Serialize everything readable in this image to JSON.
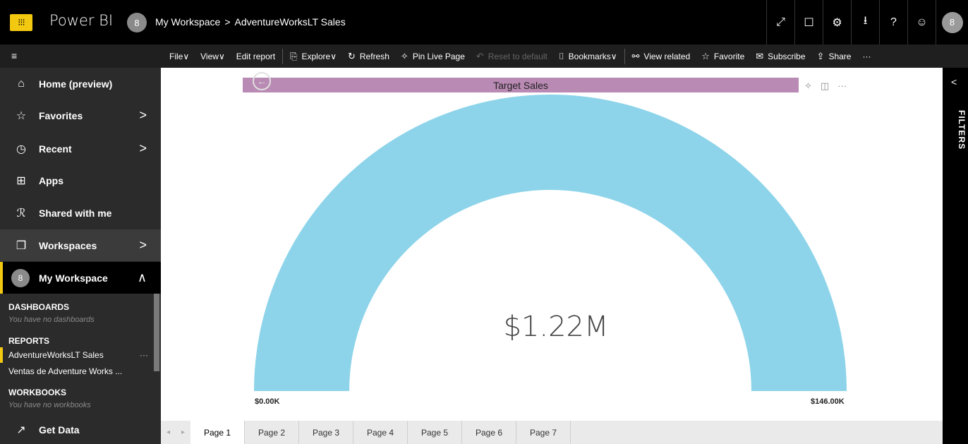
{
  "topbar": {
    "app_name": "Power BI",
    "workspace_initial": "8",
    "breadcrumb": [
      "My Workspace",
      "AdventureWorksLT Sales"
    ],
    "breadcrumb_separator": ">",
    "icons": [
      "expand-icon",
      "comment-icon",
      "settings-icon",
      "download-icon",
      "help-icon",
      "feedback-icon"
    ],
    "icon_glyphs": [
      "⤢",
      "☐",
      "⚙",
      "⭳",
      "?",
      "☺"
    ],
    "user_initial": "8"
  },
  "actionbar": {
    "menu_glyph": "≡",
    "actions": [
      {
        "label": "File",
        "suffix": " ∨",
        "icon": ""
      },
      {
        "label": "View",
        "suffix": " ∨",
        "icon": ""
      },
      {
        "label": "Edit report",
        "suffix": "",
        "icon": ""
      },
      {
        "label": "Explore",
        "suffix": " ∨",
        "icon": "⎘"
      },
      {
        "label": "Refresh",
        "suffix": "",
        "icon": "↻"
      },
      {
        "label": "Pin Live Page",
        "suffix": "",
        "icon": "✧"
      },
      {
        "label": "Reset to default",
        "suffix": "",
        "icon": "↶"
      },
      {
        "label": "Bookmarks",
        "suffix": " ∨",
        "icon": "⌷"
      },
      {
        "label": "View related",
        "suffix": "",
        "icon": "⚯"
      },
      {
        "label": "Favorite",
        "suffix": "",
        "icon": "☆"
      },
      {
        "label": "Subscribe",
        "suffix": "",
        "icon": "✉"
      },
      {
        "label": "Share",
        "suffix": "",
        "icon": "⇪"
      }
    ],
    "more_glyph": "···"
  },
  "sidebar": {
    "items": [
      {
        "label": "Home (preview)",
        "icon": "⌂"
      },
      {
        "label": "Favorites",
        "icon": "☆",
        "chevron": ">"
      },
      {
        "label": "Recent",
        "icon": "◷",
        "chevron": ">"
      },
      {
        "label": "Apps",
        "icon": "⊞"
      },
      {
        "label": "Shared with me",
        "icon": "ℛ"
      },
      {
        "label": "Workspaces",
        "icon": "❐",
        "chevron": ">"
      }
    ],
    "my_workspace": {
      "label": "My Workspace",
      "initial": "8",
      "chevron": "∧"
    },
    "dashboards_header": "DASHBOARDS",
    "dashboards_empty": "You have no dashboards",
    "reports_header": "REPORTS",
    "reports": [
      "AdventureWorksLT Sales",
      "Ventas de Adventure Works ..."
    ],
    "report_more": "···",
    "workbooks_header": "WORKBOOKS",
    "workbooks_empty": "You have no workbooks",
    "get_data": {
      "label": "Get Data",
      "icon": "↗"
    }
  },
  "visual": {
    "title": "Target Sales",
    "back_glyph": "←",
    "tool_glyphs": [
      "✧",
      "◫",
      "···"
    ],
    "title_color": "#b98ab3"
  },
  "chart_data": {
    "type": "gauge",
    "value": 1.22,
    "value_label": "$1.22M",
    "min_label": "$0.00K",
    "max_label": "$146.00K",
    "fill_color": "#8dd4ea"
  },
  "filters": {
    "label": "FILTERS",
    "chevron": "<"
  },
  "pages": {
    "arrows": [
      "◂",
      "▸"
    ],
    "tabs": [
      "Page 1",
      "Page 2",
      "Page 3",
      "Page 4",
      "Page 5",
      "Page 6",
      "Page 7"
    ],
    "active_index": 0
  }
}
